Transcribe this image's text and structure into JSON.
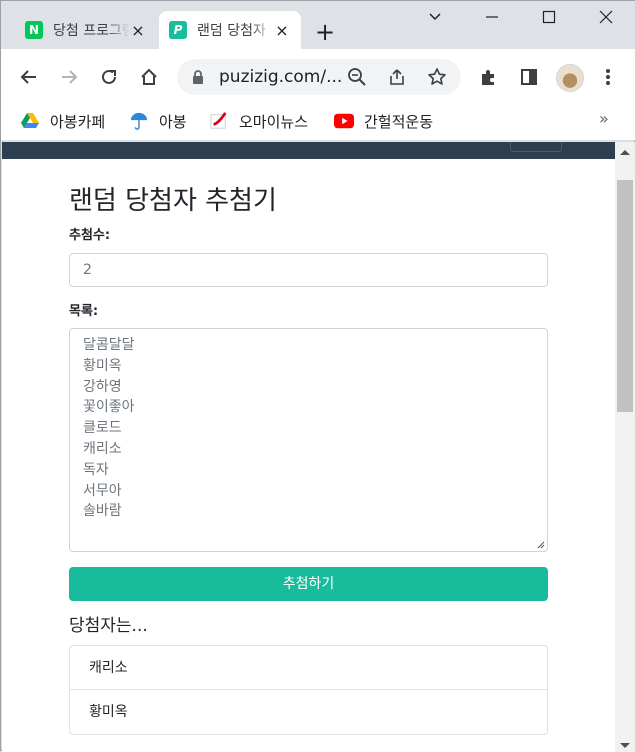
{
  "browser": {
    "tabs": [
      {
        "title": "당첨 프로그램",
        "favicon": "N",
        "close": "×"
      },
      {
        "title": "랜덤 당첨자 추첨기",
        "favicon": "P",
        "close": "×"
      }
    ],
    "new_tab": "+",
    "url": "puzizig.com/...",
    "bookmarks": [
      {
        "label": "아봉카페",
        "icon": "google-drive-icon"
      },
      {
        "label": "아봉",
        "icon": "umbrella-icon"
      },
      {
        "label": "오마이뉴스",
        "icon": "ohmynews-icon"
      },
      {
        "label": "간헐적운동",
        "icon": "youtube-icon"
      }
    ],
    "bookmarks_more": "»"
  },
  "page": {
    "title": "랜덤 당첨자 추첨기",
    "count_label": "추첨수:",
    "count_placeholder": "2",
    "list_label": "목록:",
    "list_items": [
      "달콤달달",
      "황미옥",
      "강하영",
      "꽃이좋아",
      "클로드",
      "캐리소",
      "독자",
      "서무아",
      "솔바람"
    ],
    "draw_button": "추첨하기",
    "result_title": "당첨자는...",
    "winners": [
      "캐리소",
      "황미옥"
    ]
  },
  "colors": {
    "accent": "#18bc9c",
    "navbar": "#2c3e50"
  }
}
